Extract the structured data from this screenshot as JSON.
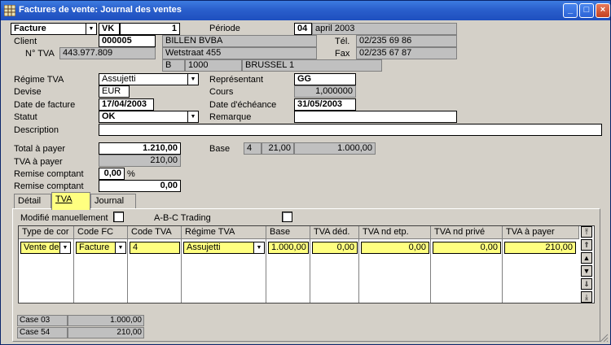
{
  "window": {
    "title": "Factures de vente: Journal des ventes",
    "minimize_label": "_",
    "maximize_label": "□",
    "close_label": "×"
  },
  "header": {
    "doc_type": "Facture",
    "journal": "VK",
    "number": "1",
    "periode_label": "Période",
    "periode_code": "04",
    "periode_text": "april 2003"
  },
  "client": {
    "label": "Client",
    "code": "000005",
    "name": "BILLEN BVBA",
    "tel_label": "Tél.",
    "tel": "02/235 69 86",
    "tva_label": "N° TVA",
    "tva": "443.977.809",
    "street": "Wetstraat 455",
    "fax_label": "Fax",
    "fax": "02/235 67 87",
    "country": "B",
    "zip": "1000",
    "city": "BRUSSEL 1"
  },
  "details": {
    "regime_label": "Régime TVA",
    "regime": "Assujetti",
    "representant_label": "Représentant",
    "representant": "GG",
    "devise_label": "Devise",
    "devise": "EUR",
    "cours_label": "Cours",
    "cours": "1,000000",
    "date_facture_label": "Date de facture",
    "date_facture": "17/04/2003",
    "echeance_label": "Date d'échéance",
    "echeance": "31/05/2003",
    "statut_label": "Statut",
    "statut": "OK",
    "remarque_label": "Remarque",
    "remarque": "",
    "description_label": "Description",
    "description": ""
  },
  "totals": {
    "total_label": "Total à payer",
    "total": "1.210,00",
    "tva_label": "TVA à payer",
    "tva": "210,00",
    "remise_label": "Remise comptant",
    "remise_pct": "0,00",
    "pct_sign": "%",
    "remise_amount_label": "Remise comptant",
    "remise_amount": "0,00",
    "base_label": "Base",
    "base_code": "4",
    "base_rate": "21,00",
    "base_amount": "1.000,00"
  },
  "tabs": {
    "detail": "Détail",
    "tva": "TVA",
    "journal": "Journal"
  },
  "tva_tab": {
    "modifie_label": "Modifié manuellement",
    "abc_label": "A-B-C Trading",
    "columns": [
      "Type de cor",
      "Code FC",
      "Code TVA",
      "Régime TVA",
      "Base",
      "TVA déd.",
      "TVA nd etp.",
      "TVA nd privé",
      "TVA à payer"
    ],
    "row": {
      "type": "Vente de",
      "code_fc": "Facture",
      "code_tva": "4",
      "regime": "Assujetti",
      "base": "1.000,00",
      "tva_ded": "0,00",
      "tva_nd_etp": "0,00",
      "tva_nd_prive": "0,00",
      "tva_a_payer": "210,00"
    }
  },
  "cases": [
    {
      "label": "Case 03",
      "value": "1.000,00"
    },
    {
      "label": "Case 54",
      "value": "210,00"
    }
  ],
  "colors": {
    "title_bar": "#2a5fcc",
    "highlight": "#ffff80",
    "window_bg": "#d4d0c8"
  }
}
